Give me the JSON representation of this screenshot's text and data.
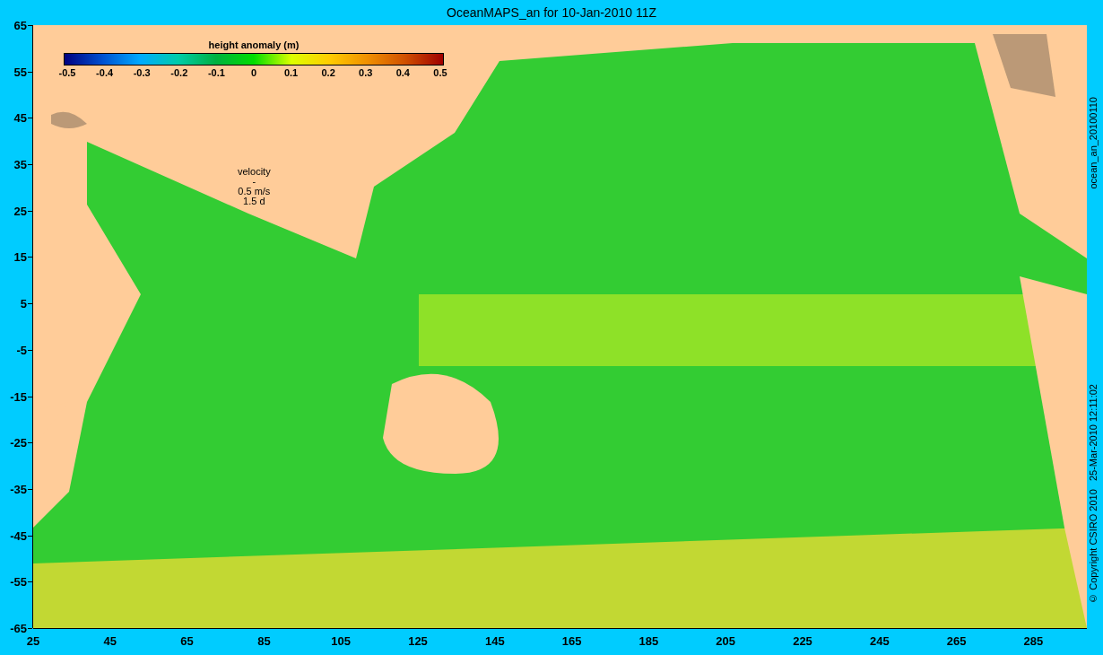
{
  "title": "OceanMAPS_an for 10-Jan-2010 11Z",
  "y_axis_labels": [
    "65",
    "55",
    "45",
    "35",
    "25",
    "15",
    "5",
    "-5",
    "-15",
    "-25",
    "-35",
    "-45",
    "-55",
    "-65"
  ],
  "x_axis_labels": [
    "25",
    "45",
    "65",
    "85",
    "105",
    "125",
    "145",
    "165",
    "185",
    "205",
    "225",
    "245",
    "265",
    "285"
  ],
  "colorbar": {
    "title": "height anomaly (m)",
    "ticks": [
      "-0.5",
      "-0.4",
      "-0.3",
      "-0.2",
      "-0.1",
      "0",
      "0.1",
      "0.2",
      "0.3",
      "0.4",
      "0.5"
    ]
  },
  "velocity_legend": [
    "velocity",
    "-",
    "0.5 m/s",
    "1.5 d"
  ],
  "side_labels": [
    "ocean_an_20100110",
    "© Copyright CSIRO 2010   25-Mar-2010 12:11:02"
  ]
}
